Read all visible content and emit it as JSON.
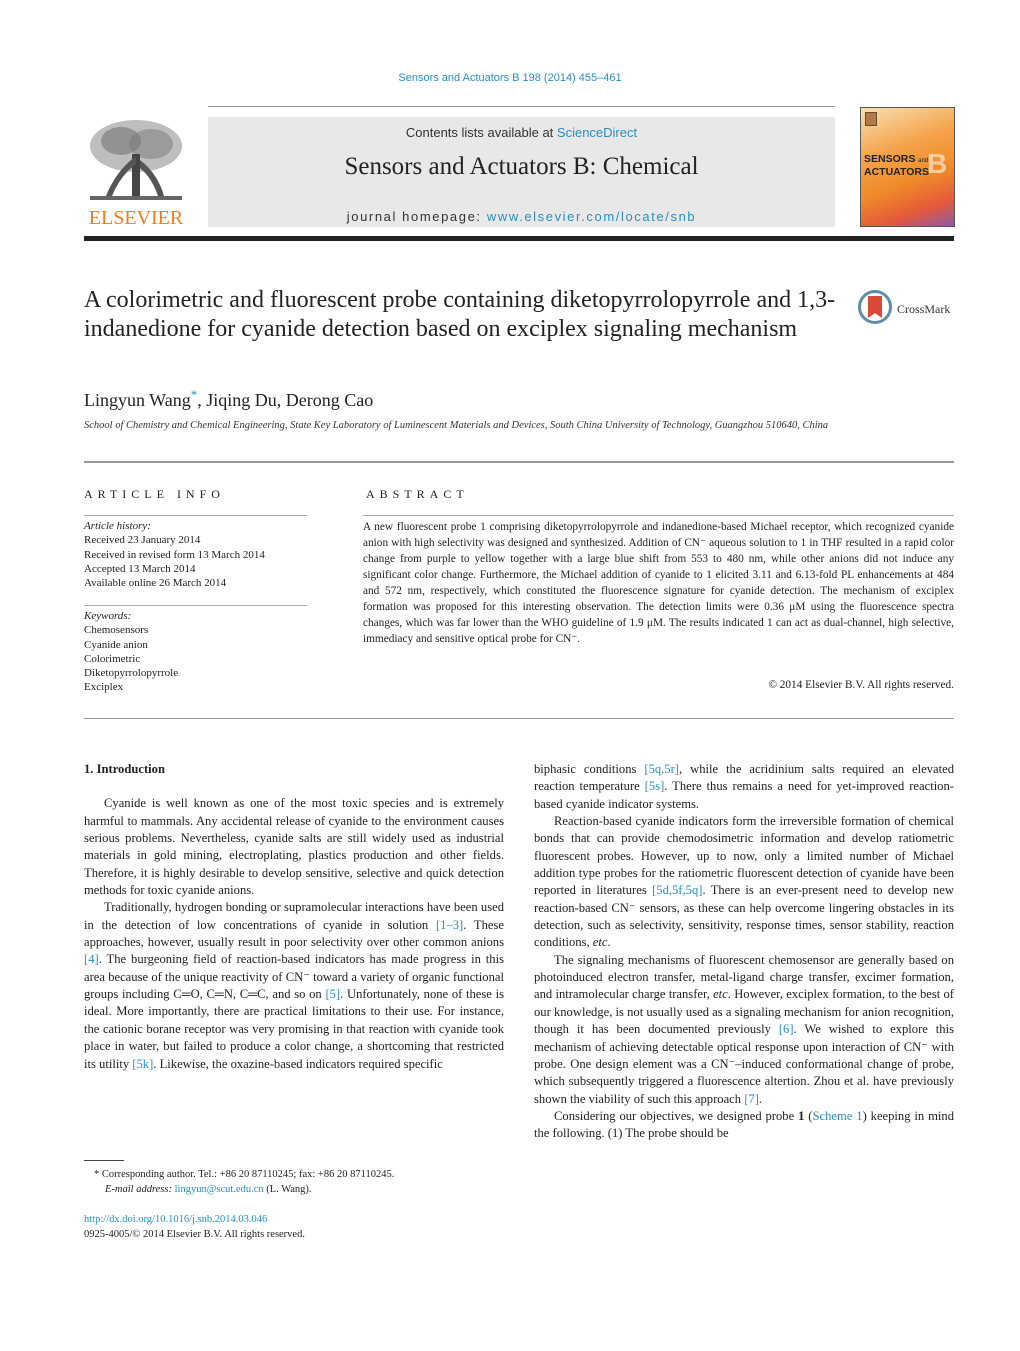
{
  "header": {
    "citation": "Sensors and Actuators B 198 (2014) 455–461",
    "publisher_logo_text": "ELSEVIER",
    "contents_prefix": "Contents lists available at ",
    "contents_link": "ScienceDirect",
    "journal_name": "Sensors and Actuators B: Chemical",
    "homepage_prefix": "journal homepage: ",
    "homepage_link": "www.elsevier.com/locate/snb",
    "cover": {
      "title_line1": "SENSORS",
      "title_and": "and",
      "title_line2": "ACTUATORS",
      "letter": "B"
    },
    "colors": {
      "link": "#2a8ec0",
      "elsevier_orange": "#f07c1d"
    }
  },
  "article": {
    "title": "A colorimetric and fluorescent probe containing diketopyrrolopyrrole and 1,3-indanedione for cyanide detection based on exciplex signaling mechanism",
    "crossmark_label": "CrossMark",
    "authors": [
      {
        "name": "Lingyun Wang",
        "corresponding": "*",
        "sep": ", "
      },
      {
        "name": "Jiqing Du",
        "sep": ", "
      },
      {
        "name": "Derong Cao",
        "sep": ""
      }
    ],
    "affiliation": "School of Chemistry and Chemical Engineering, State Key Laboratory of Luminescent Materials and Devices, South China University of Technology, Guangzhou 510640, China"
  },
  "article_info": {
    "heading": "ARTICLE INFO",
    "history_label": "Article history:",
    "history": [
      "Received 23 January 2014",
      "Received in revised form 13 March 2014",
      "Accepted 13 March 2014",
      "Available online 26 March 2014"
    ],
    "keywords_label": "Keywords:",
    "keywords": [
      "Chemosensors",
      "Cyanide anion",
      "Colorimetric",
      "Diketopyrrolopyrrole",
      "Exciplex"
    ]
  },
  "abstract": {
    "heading": "ABSTRACT",
    "text": "A new fluorescent probe 1 comprising diketopyrrolopyrrole and indanedione-based Michael receptor, which recognized cyanide anion with high selectivity was designed and synthesized. Addition of CN⁻ aqueous solution to 1 in THF resulted in a rapid color change from purple to yellow together with a large blue shift from 553 to 480 nm, while other anions did not induce any significant color change. Furthermore, the Michael addition of cyanide to 1 elicited 3.11 and 6.13-fold PL enhancements at 484 and 572 nm, respectively, which constituted the fluorescence signature for cyanide detection. The mechanism of exciplex formation was proposed for this interesting observation. The detection limits were 0.36 μM using the fluorescence spectra changes, which was far lower than the WHO guideline of 1.9 μM. The results indicated 1 can act as dual-channel, high selective, immediacy and sensitive optical probe for CN⁻.",
    "copyright": "© 2014 Elsevier B.V. All rights reserved."
  },
  "body": {
    "intro_heading": "1.  Introduction",
    "left": {
      "p1": "Cyanide is well known as one of the most toxic species and is extremely harmful to mammals. Any accidental release of cyanide to the environment causes serious problems. Nevertheless, cyanide salts are still widely used as industrial materials in gold mining, electroplating, plastics production and other fields. Therefore, it is highly desirable to develop sensitive, selective and quick detection methods for toxic cyanide anions.",
      "p2": [
        {
          "t": "Traditionally, hydrogen bonding or supramolecular interactions have been used in the detection of low concentrations of cyanide in solution "
        },
        {
          "c": "[1–3]"
        },
        {
          "t": ". These approaches, however, usually result in poor selectivity over other common anions "
        },
        {
          "c": "[4]"
        },
        {
          "t": ". The burgeoning field of reaction-based indicators has made progress in this area because of the unique reactivity of CN⁻ toward a variety of organic functional groups including C═O, C═N, C═C, and so on "
        },
        {
          "c": "[5]"
        },
        {
          "t": ". Unfortunately, none of these is ideal. More importantly, there are practical limitations to their use. For instance, the cationic borane receptor was very promising in that reaction with cyanide took place in water, but failed to produce a color change, a shortcoming that restricted its utility "
        },
        {
          "c": "[5k]"
        },
        {
          "t": ". Likewise, the oxazine-based indicators required specific"
        }
      ]
    },
    "right": {
      "p1": [
        {
          "t": "biphasic conditions "
        },
        {
          "c": "[5q,5r]"
        },
        {
          "t": ", while the acridinium salts required an elevated reaction temperature "
        },
        {
          "c": "[5s]"
        },
        {
          "t": ". There thus remains a need for yet-improved reaction-based cyanide indicator systems."
        }
      ],
      "p2": [
        {
          "t": "Reaction-based cyanide indicators form the irreversible formation of chemical bonds that can provide chemodosimetric information and develop ratiometric fluorescent probes. However, up to now, only a limited number of Michael addition type probes for the ratiometric fluorescent detection of cyanide have been reported in literatures "
        },
        {
          "c": "[5d,5f,5q]"
        },
        {
          "t": ". There is an ever-present need to develop new reaction-based CN⁻ sensors, as these can help overcome lingering obstacles in its detection, such as selectivity, sensitivity, response times, sensor stability, reaction conditions, "
        },
        {
          "i": "etc"
        },
        {
          "t": "."
        }
      ],
      "p3": [
        {
          "t": "The signaling mechanisms of fluorescent chemosensor are generally based on photoinduced electron transfer, metal-ligand charge transfer, excimer formation, and intramolecular charge transfer, "
        },
        {
          "i": "etc"
        },
        {
          "t": ". However, exciplex formation, to the best of our knowledge, is not usually used as a signaling mechanism for anion recognition, though it has been documented previously "
        },
        {
          "c": "[6]"
        },
        {
          "t": ". We wished to explore this mechanism of achieving detectable optical response upon interaction of CN⁻ with probe. One design element was a CN⁻–induced conformational change of probe, which subsequently triggered a fluorescence altertion. Zhou et al. have previously shown the viability of such this approach "
        },
        {
          "c": "[7]"
        },
        {
          "t": "."
        }
      ],
      "p4": [
        {
          "t": "Considering our objectives, we designed probe "
        },
        {
          "b": "1"
        },
        {
          "t": " ("
        },
        {
          "c": "Scheme 1"
        },
        {
          "t": ") keeping in mind the following. (1) The probe should be"
        }
      ]
    }
  },
  "footnote": {
    "star": "*",
    "corresponding": " Corresponding author. Tel.: +86 20 87110245; fax: +86 20 87110245.",
    "email_label": "E-mail address: ",
    "email": "lingyun@scut.edu.cn",
    "email_suffix": " (L. Wang)."
  },
  "doi": {
    "link": "http://dx.doi.org/10.1016/j.snb.2014.03.046",
    "issn_line": "0925-4005/© 2014 Elsevier B.V. All rights reserved."
  }
}
